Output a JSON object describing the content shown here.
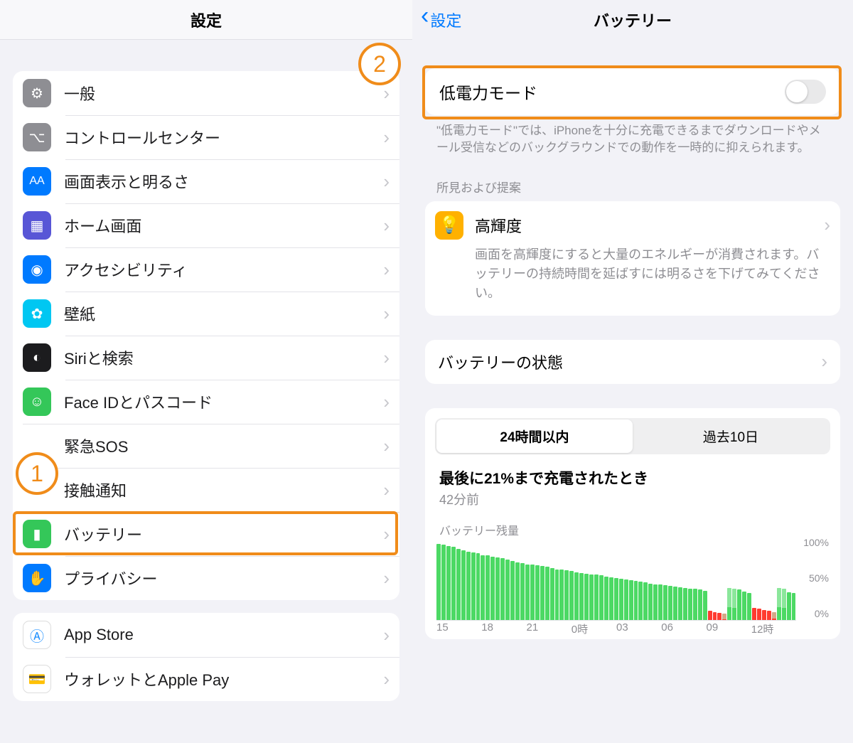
{
  "left": {
    "title": "設定",
    "group1": [
      {
        "label": "一般",
        "icon": "gear",
        "bg": "ic-gray"
      },
      {
        "label": "コントロールセンター",
        "icon": "switches",
        "bg": "ic-gray2"
      },
      {
        "label": "画面表示と明るさ",
        "icon": "AA",
        "bg": "ic-blue"
      },
      {
        "label": "ホーム画面",
        "icon": "grid",
        "bg": "ic-purple"
      },
      {
        "label": "アクセシビリティ",
        "icon": "person",
        "bg": "ic-blue"
      },
      {
        "label": "壁紙",
        "icon": "flower",
        "bg": "ic-cyan"
      },
      {
        "label": "Siriと検索",
        "icon": "siri",
        "bg": "ic-siri"
      },
      {
        "label": "Face IDとパスコード",
        "icon": "face",
        "bg": "ic-green"
      },
      {
        "label": "緊急SOS",
        "icon": "",
        "bg": ""
      },
      {
        "label": "接触通知",
        "icon": "",
        "bg": ""
      },
      {
        "label": "バッテリー",
        "icon": "battery",
        "bg": "ic-green",
        "highlight": true
      },
      {
        "label": "プライバシー",
        "icon": "hand",
        "bg": "ic-hand"
      }
    ],
    "group2": [
      {
        "label": "App Store",
        "icon": "A",
        "bg": "ic-store"
      },
      {
        "label": "ウォレットとApple Pay",
        "icon": "wallet",
        "bg": "ic-wallet"
      }
    ]
  },
  "right": {
    "back": "設定",
    "title": "バッテリー",
    "lowpower": {
      "label": "低電力モード",
      "on": false
    },
    "lowpower_desc": "\"低電力モード\"では、iPhoneを十分に充電できるまでダウンロードやメール受信などのバックグラウンドでの動作を一時的に抑えられます。",
    "suggest_header": "所見および提案",
    "suggest": {
      "title": "高輝度",
      "body": "画面を高輝度にすると大量のエネルギーが消費されます。バッテリーの持続時間を延ばすには明るさを下げてみてください。"
    },
    "health": "バッテリーの状態",
    "seg": [
      "24時間以内",
      "過去10日"
    ],
    "seg_active": 0,
    "charge_title": "最後に21%まで充電されたとき",
    "charge_sub": "42分前",
    "chart_label": "バッテリー残量"
  },
  "annotations": {
    "circle1": "1",
    "circle2": "2"
  },
  "chart_data": {
    "type": "bar",
    "title": "バッテリー残量",
    "xlabel": "",
    "ylabel": "%",
    "ylim": [
      0,
      100
    ],
    "yticks": [
      0,
      50,
      100
    ],
    "xticks": [
      "15",
      "18",
      "21",
      "0時",
      "03",
      "06",
      "09",
      "12時"
    ],
    "values": [
      96,
      95,
      93,
      92,
      90,
      88,
      86,
      85,
      84,
      82,
      82,
      80,
      79,
      78,
      76,
      74,
      73,
      72,
      70,
      70,
      69,
      68,
      67,
      65,
      64,
      64,
      63,
      62,
      60,
      59,
      58,
      57,
      57,
      56,
      55,
      54,
      53,
      52,
      51,
      50,
      49,
      48,
      47,
      46,
      45,
      45,
      44,
      43,
      42,
      41,
      40,
      39,
      39,
      38,
      37,
      11,
      10,
      9,
      8,
      40,
      39,
      38,
      36,
      34,
      15,
      14,
      12,
      11,
      10,
      40,
      39,
      35,
      34
    ],
    "low_indices": [
      55,
      56,
      57,
      58,
      64,
      65,
      66,
      67,
      68
    ],
    "charge_bands": [
      {
        "start": 58,
        "end": 60
      },
      {
        "start": 68,
        "end": 70
      }
    ]
  }
}
